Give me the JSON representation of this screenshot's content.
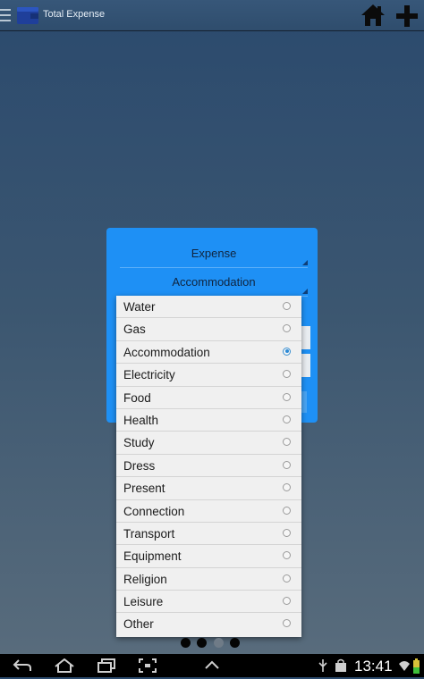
{
  "actionbar": {
    "title": "Total Expense"
  },
  "dialog": {
    "type_spinner": "Expense",
    "category_spinner": "Accommodation"
  },
  "dropdown": {
    "selected": "Accommodation",
    "items": [
      {
        "label": "Water",
        "checked": false
      },
      {
        "label": "Gas",
        "checked": false
      },
      {
        "label": "Accommodation",
        "checked": true
      },
      {
        "label": "Electricity",
        "checked": false
      },
      {
        "label": "Food",
        "checked": false
      },
      {
        "label": "Health",
        "checked": false
      },
      {
        "label": "Study",
        "checked": false
      },
      {
        "label": "Dress",
        "checked": false
      },
      {
        "label": "Present",
        "checked": false
      },
      {
        "label": "Connection",
        "checked": false
      },
      {
        "label": "Transport",
        "checked": false
      },
      {
        "label": "Equipment",
        "checked": false
      },
      {
        "label": "Religion",
        "checked": false
      },
      {
        "label": "Leisure",
        "checked": false
      },
      {
        "label": "Other",
        "checked": false
      }
    ]
  },
  "pager": {
    "count": 4,
    "active_index": 2
  },
  "statusbar": {
    "time": "13:41"
  },
  "colors": {
    "dialog_bg": "#1e90f5",
    "radio_checked": "#2c8ad6",
    "background": "#3b5670"
  },
  "icons": [
    "menu-icon",
    "wallet-icon",
    "home-icon",
    "plus-icon",
    "back-icon",
    "home-nav-icon",
    "recents-icon",
    "screenshot-icon",
    "up-arrow-icon",
    "usb-icon",
    "bag-icon",
    "wifi-icon",
    "battery-icon"
  ]
}
